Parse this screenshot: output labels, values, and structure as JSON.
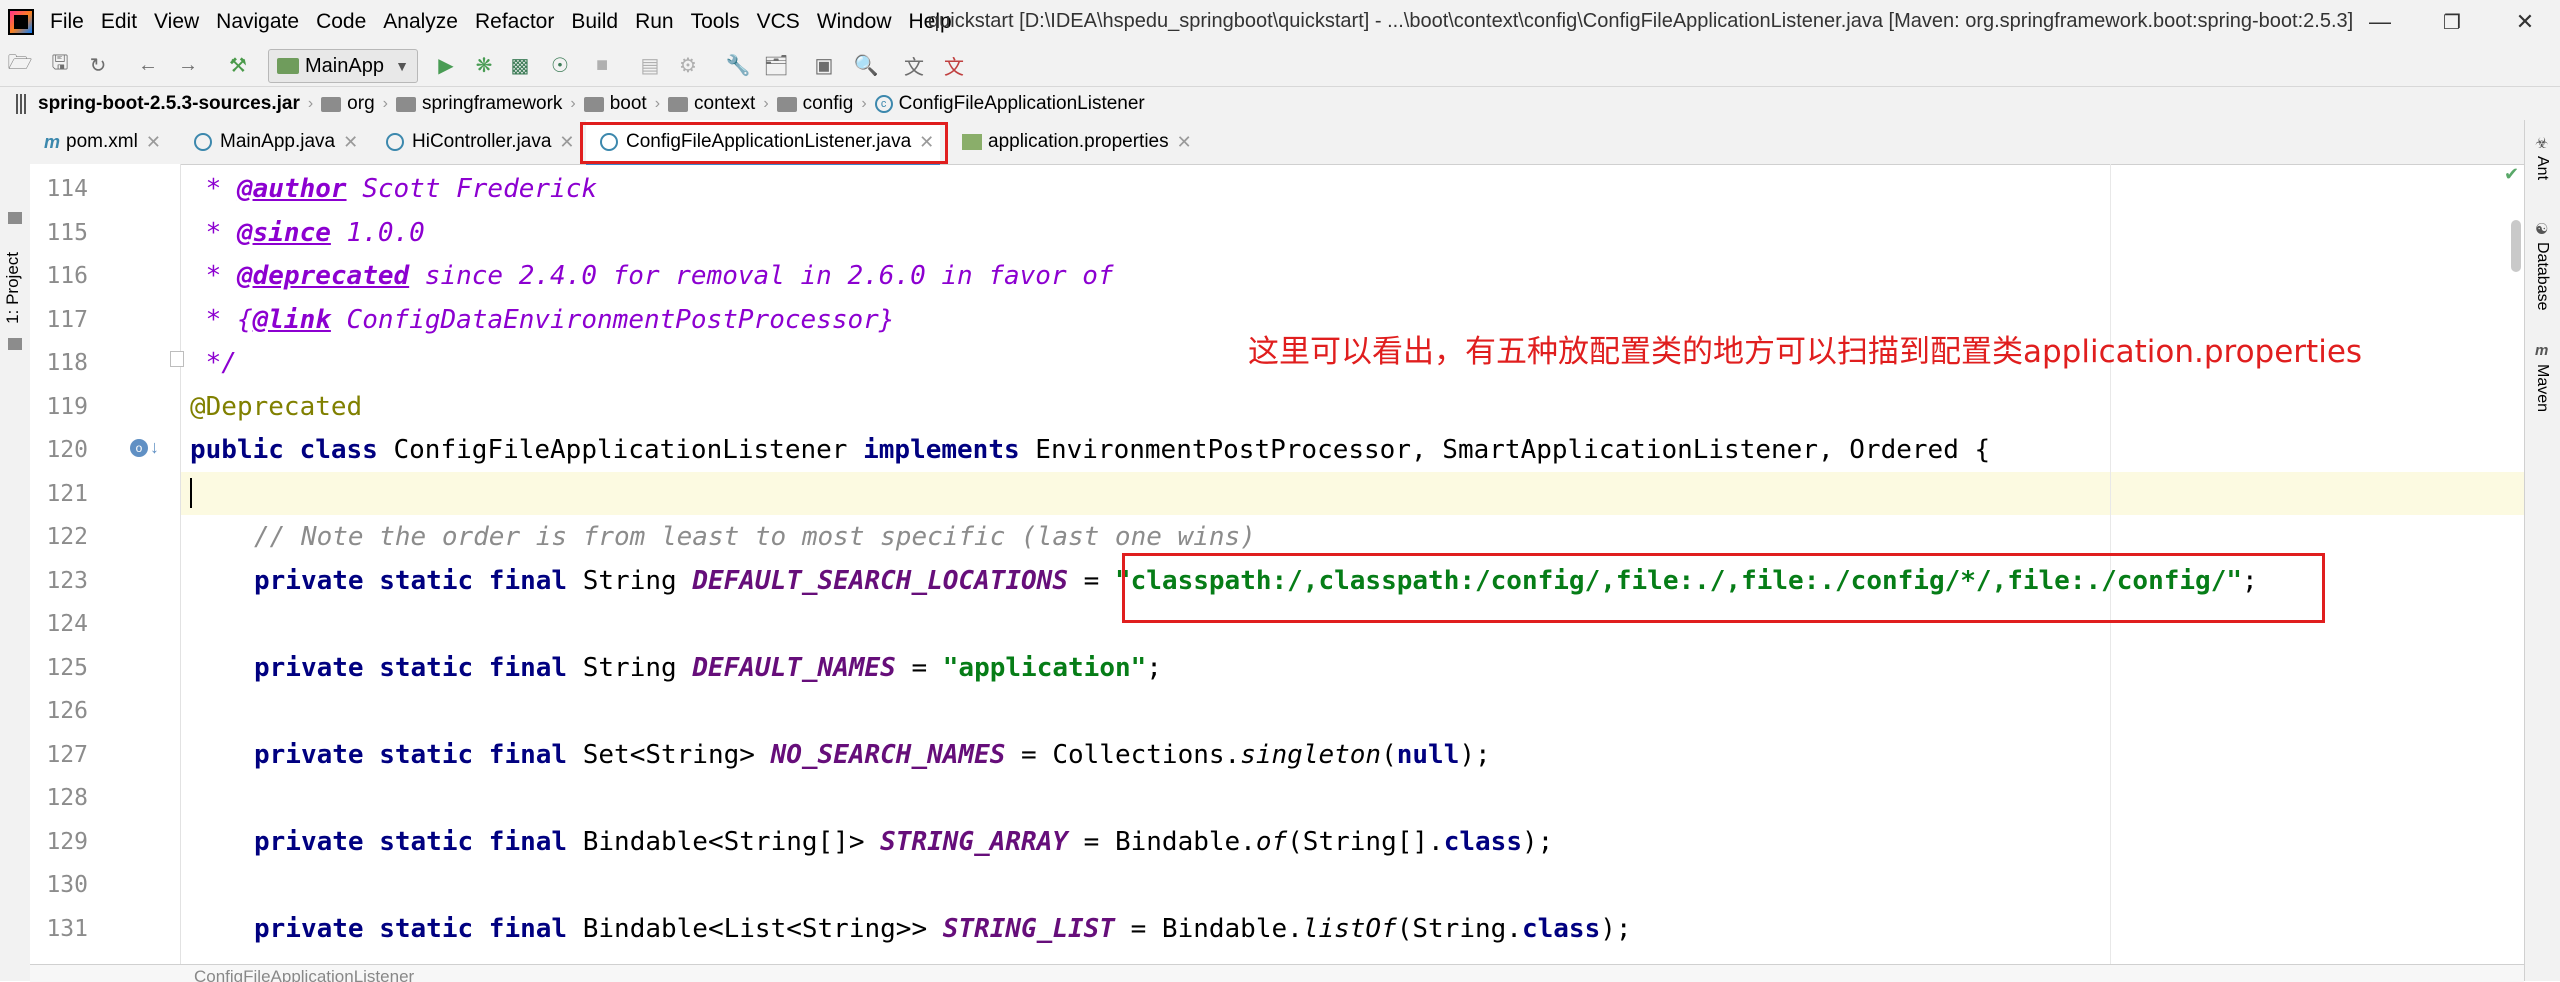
{
  "menu": {
    "items": [
      "File",
      "Edit",
      "View",
      "Navigate",
      "Code",
      "Analyze",
      "Refactor",
      "Build",
      "Run",
      "Tools",
      "VCS",
      "Window",
      "Help"
    ],
    "window_title": "quickstart [D:\\IDEA\\hspedu_springboot\\quickstart] - ...\\boot\\context\\config\\ConfigFileApplicationListener.java [Maven: org.springframework.boot:spring-boot:2.5.3]"
  },
  "toolbar": {
    "run_config": "MainApp",
    "icons": [
      "folder-open-icon",
      "save-icon",
      "sync-icon",
      "back-icon",
      "forward-icon",
      "hammer-icon",
      "run-icon",
      "debug-icon",
      "coverage-icon",
      "profile-icon",
      "stop-icon",
      "git-icon",
      "wrench-icon",
      "project-structure-icon",
      "search-icon",
      "translate-icon"
    ]
  },
  "breadcrumb": {
    "items": [
      "spring-boot-2.5.3-sources.jar",
      "org",
      "springframework",
      "boot",
      "context",
      "config",
      "ConfigFileApplicationListener"
    ]
  },
  "sidebar": {
    "left_label": "1: Project",
    "right_labels": [
      "Ant",
      "Database",
      "Maven"
    ]
  },
  "tabs": [
    {
      "label": "pom.xml",
      "icon": "maven-icon"
    },
    {
      "label": "MainApp.java",
      "icon": "class-icon"
    },
    {
      "label": "HiController.java",
      "icon": "class-icon"
    },
    {
      "label": "ConfigFileApplicationListener.java",
      "icon": "class-icon",
      "active": true
    },
    {
      "label": "application.properties",
      "icon": "properties-icon"
    }
  ],
  "editor": {
    "line_numbers": [
      "114",
      "115",
      "116",
      "117",
      "118",
      "119",
      "120",
      "121",
      "122",
      "123",
      "124",
      "125",
      "126",
      "127",
      "128",
      "129",
      "130",
      "131"
    ],
    "code": {
      "l114_prefix": " * ",
      "l114_tag": "@author",
      "l114_text": " Scott Frederick",
      "l115_prefix": " * ",
      "l115_tag": "@since",
      "l115_text": " 1.0.0",
      "l116_prefix": " * ",
      "l116_tag": "@deprecated",
      "l116_text": " since 2.4.0 for removal in 2.6.0 in favor of",
      "l117_prefix": " * {",
      "l117_tag": "@link",
      "l117_text": " ConfigDataEnvironmentPostProcessor}",
      "l118": " */",
      "l119": "@Deprecated",
      "l120_kw1": "public class",
      "l120_name": " ConfigFileApplicationListener ",
      "l120_kw2": "implements",
      "l120_rest": " EnvironmentPostProcessor, SmartApplicationListener, Ordered {",
      "l122": "// Note the order is from least to most specific (last one wins)",
      "l123_kw": "private static final",
      "l123_type": " String ",
      "l123_field": "DEFAULT_SEARCH_LOCATIONS",
      "l123_eq": " = ",
      "l123_str": "\"classpath:/,classpath:/config/,file:./,file:./config/*/,file:./config/\"",
      "l123_end": ";",
      "l125_kw": "private static final",
      "l125_type": " String ",
      "l125_field": "DEFAULT_NAMES",
      "l125_eq": " = ",
      "l125_str": "\"application\"",
      "l125_end": ";",
      "l127_kw": "private static final",
      "l127_type": " Set<String> ",
      "l127_field": "NO_SEARCH_NAMES",
      "l127_eq": " = Collections.",
      "l127_method": "singleton",
      "l127_open": "(",
      "l127_null": "null",
      "l127_end": ");",
      "l129_kw": "private static final",
      "l129_type": " Bindable<String[]> ",
      "l129_field": "STRING_ARRAY",
      "l129_eq": " = Bindable.",
      "l129_method": "of",
      "l129_arg": "(String[].",
      "l129_class": "class",
      "l129_end": ");",
      "l131_kw": "private static final",
      "l131_type": " Bindable<List<String>> ",
      "l131_field": "STRING_LIST",
      "l131_eq": " = Bindable.",
      "l131_method": "listOf",
      "l131_arg": "(String.",
      "l131_class": "class",
      "l131_end": ");"
    },
    "annotation_note": "这里可以看出，有五种放配置类的地方可以扫描到配置类application.properties"
  },
  "status": {
    "breadcrumb_text": "ConfigFileApplicationListener"
  },
  "colors": {
    "highlight_box": "#e01e1e",
    "keyword": "#000080",
    "string": "#067d17",
    "field": "#660e7a",
    "javadoc": "#8c00d0",
    "annotation": "#808000",
    "comment": "#8c8c8c",
    "current_line": "#fcfae1"
  }
}
